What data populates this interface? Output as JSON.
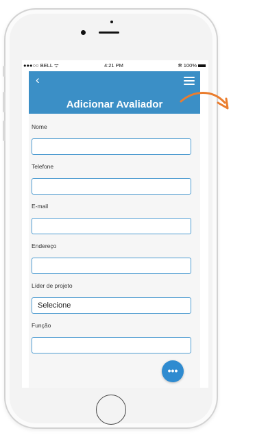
{
  "status_bar": {
    "carrier": "●●●○○ BELL ᯤ",
    "time": "4:21 PM",
    "battery": "✻ 100%"
  },
  "header": {
    "back_icon": "chevron-left-icon",
    "back_glyph": "‹",
    "menu_icon": "hamburger-menu-icon",
    "title": "Adicionar Avaliador"
  },
  "form": {
    "fields": [
      {
        "label": "Nome",
        "value": ""
      },
      {
        "label": "Telefone",
        "value": ""
      },
      {
        "label": "E-mail",
        "value": ""
      },
      {
        "label": "Endereço",
        "value": ""
      },
      {
        "label": "Líder de projeto",
        "value": "Selecione"
      },
      {
        "label": "Função",
        "value": ""
      }
    ]
  },
  "fab": {
    "icon": "more-options-icon",
    "glyph": "•••"
  },
  "colors": {
    "accent": "#3b8fc6",
    "field_border": "#4b9ad0",
    "fab": "#2f8bd0",
    "arrow": "#ea7d2e"
  }
}
